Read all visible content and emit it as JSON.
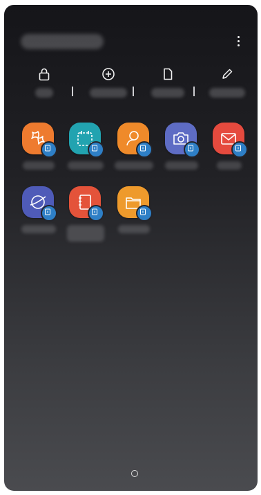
{
  "header": {
    "title": "",
    "more_icon": "more-vert-icon"
  },
  "actions": [
    {
      "icon": "lock-icon",
      "label": ""
    },
    {
      "icon": "add-circle-icon",
      "label": ""
    },
    {
      "icon": "file-icon",
      "label": ""
    },
    {
      "icon": "pencil-icon",
      "label": ""
    }
  ],
  "apps": [
    {
      "name": "",
      "icon": "gallery-icon",
      "color": "#ee7b2f"
    },
    {
      "name": "",
      "icon": "calendar-icon",
      "color": "#22a3b0"
    },
    {
      "name": "",
      "icon": "contacts-icon",
      "color": "#ef8a2a"
    },
    {
      "name": "",
      "icon": "camera-icon",
      "color": "#5e6cc4"
    },
    {
      "name": "",
      "icon": "email-icon",
      "color": "#e54a3e"
    },
    {
      "name": "",
      "icon": "internet-icon",
      "color": "#4f5bb8"
    },
    {
      "name": "",
      "icon": "notes-icon",
      "color": "#e4533a"
    },
    {
      "name": "",
      "icon": "my-files-icon",
      "color": "#ee9a2c"
    }
  ],
  "nav": {
    "home_icon": "home-icon"
  }
}
